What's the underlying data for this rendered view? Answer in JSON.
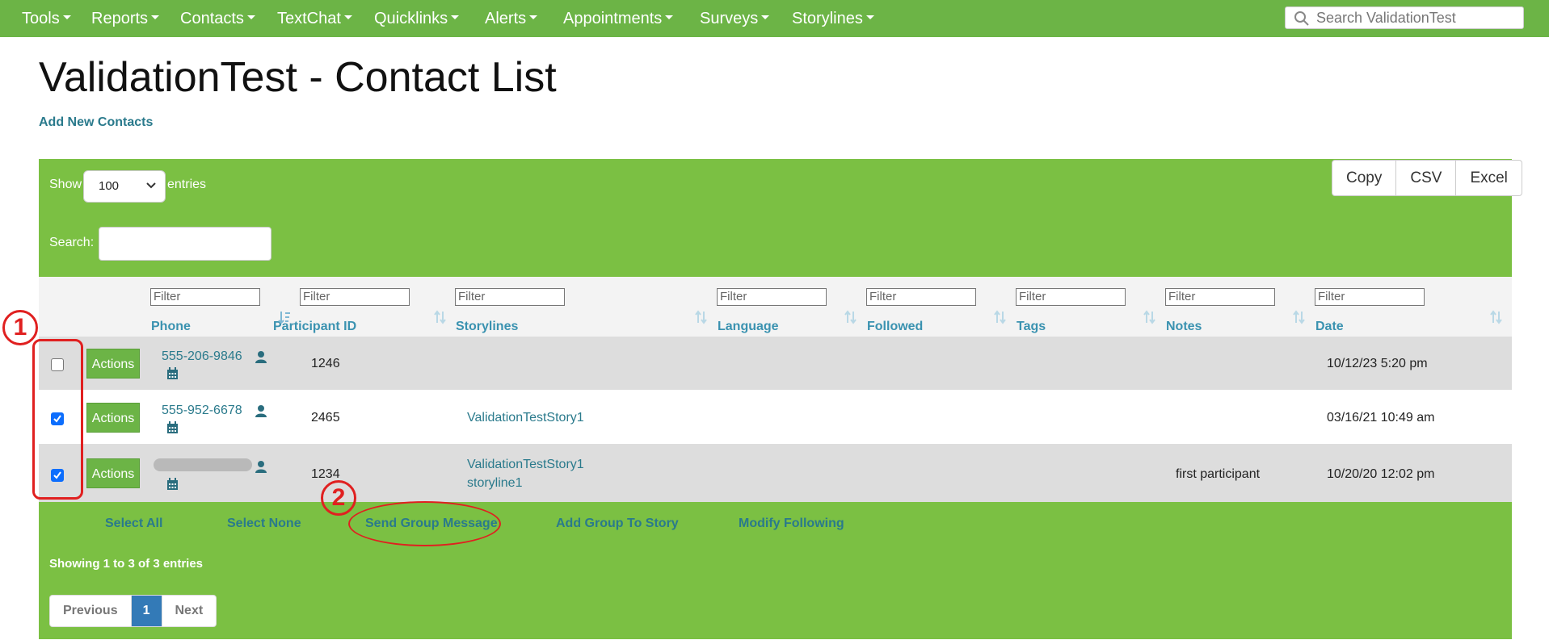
{
  "nav": {
    "items": [
      "Tools",
      "Reports",
      "Contacts",
      "TextChat",
      "Quicklinks",
      "Alerts",
      "Appointments",
      "Surveys",
      "Storylines"
    ],
    "search_placeholder": "Search ValidationTest"
  },
  "page": {
    "title": "ValidationTest - Contact List",
    "add_link": "Add New Contacts"
  },
  "controls": {
    "show_label": "Show",
    "length_value": "100",
    "entries_label": "entries",
    "search_label": "Search:",
    "export_buttons": [
      "Copy",
      "CSV",
      "Excel"
    ]
  },
  "table": {
    "filter_placeholder": "Filter",
    "columns": [
      "Phone",
      "Participant ID",
      "Storylines",
      "Language",
      "Followed",
      "Tags",
      "Notes",
      "Date"
    ],
    "actions_label": "Actions",
    "rows": [
      {
        "checked": false,
        "phone": "555-206-9846",
        "participant_id": "1246",
        "storylines": [],
        "notes": "",
        "date": "10/12/23 5:20 pm"
      },
      {
        "checked": true,
        "phone": "555-952-6678",
        "participant_id": "2465",
        "storylines": [
          "ValidationTestStory1"
        ],
        "notes": "",
        "date": "03/16/21 10:49 am"
      },
      {
        "checked": true,
        "phone": "",
        "participant_id": "1234",
        "storylines": [
          "ValidationTestStory1",
          "storyline1"
        ],
        "notes": "first participant",
        "date": "10/20/20 12:02 pm"
      }
    ]
  },
  "group_actions": [
    "Select All",
    "Select None",
    "Send Group Message",
    "Add Group To Story",
    "Modify Following"
  ],
  "footer": {
    "info": "Showing 1 to 3 of 3 entries",
    "pager": [
      "Previous",
      "1",
      "Next"
    ]
  },
  "annotations": [
    "1",
    "2"
  ],
  "colors": {
    "navbar": "#6cb446",
    "panel": "#7bc043",
    "link": "#2a7a8c",
    "header_link": "#3a92b0",
    "annotation": "#e02020",
    "active_page": "#337ab7"
  }
}
